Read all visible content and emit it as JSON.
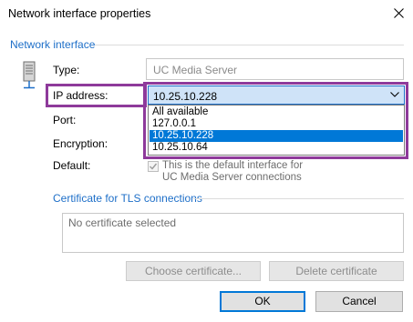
{
  "dialog": {
    "title": "Network interface properties"
  },
  "network_interface": {
    "group_title": "Network interface",
    "type_label": "Type:",
    "type_value": "UC Media Server",
    "ip_label": "IP address:",
    "ip_value": "10.25.10.228",
    "ip_options": [
      "All available",
      "127.0.0.1",
      "10.25.10.228",
      "10.25.10.64"
    ],
    "ip_selected_index": 2,
    "port_label": "Port:",
    "encryption_label": "Encryption:",
    "default_label": "Default:",
    "default_checkbox_label_line1": "This is the default interface for",
    "default_checkbox_label_line2": "UC Media Server connections",
    "default_checked": true
  },
  "certificate": {
    "group_title": "Certificate for TLS connections",
    "status_text": "No certificate selected",
    "choose_label": "Choose certificate...",
    "delete_label": "Delete certificate"
  },
  "buttons": {
    "ok": "OK",
    "cancel": "Cancel"
  },
  "colors": {
    "accent": "#1E6FC8",
    "highlight_frame": "#8E3A9B",
    "selection": "#0078D7"
  }
}
